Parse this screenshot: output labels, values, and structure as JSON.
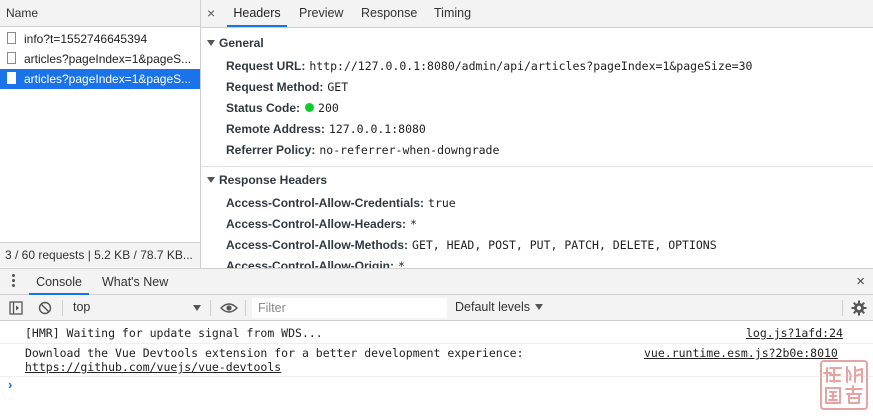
{
  "network": {
    "name_header": "Name",
    "requests": [
      {
        "name": "info?t=1552746645394",
        "selected": false
      },
      {
        "name": "articles?pageIndex=1&pageS...",
        "selected": false
      },
      {
        "name": "articles?pageIndex=1&pageS...",
        "selected": true
      }
    ],
    "summary": "3 / 60 requests | 5.2 KB / 78.7 KB..."
  },
  "detail": {
    "close_glyph": "×",
    "tabs": [
      "Headers",
      "Preview",
      "Response",
      "Timing"
    ],
    "active_tab": "Headers",
    "general": {
      "title": "General",
      "rows": [
        {
          "key": "Request URL:",
          "value": "http://127.0.0.1:8080/admin/api/articles?pageIndex=1&pageSize=30"
        },
        {
          "key": "Request Method:",
          "value": "GET"
        },
        {
          "key": "Status Code:",
          "value": "200"
        },
        {
          "key": "Remote Address:",
          "value": "127.0.0.1:8080"
        },
        {
          "key": "Referrer Policy:",
          "value": "no-referrer-when-downgrade"
        }
      ],
      "status_color": "#0ccc2a"
    },
    "response_headers": {
      "title": "Response Headers",
      "rows": [
        {
          "key": "Access-Control-Allow-Credentials:",
          "value": "true"
        },
        {
          "key": "Access-Control-Allow-Headers:",
          "value": "*"
        },
        {
          "key": "Access-Control-Allow-Methods:",
          "value": "GET, HEAD, POST, PUT, PATCH, DELETE, OPTIONS"
        },
        {
          "key": "Access-Control-Allow-Origin:",
          "value": "*"
        }
      ]
    }
  },
  "drawer": {
    "tabs": [
      "Console",
      "What's New"
    ],
    "active_tab": "Console",
    "close_glyph": "×"
  },
  "console_toolbar": {
    "context": "top",
    "filter_placeholder": "Filter",
    "levels": "Default levels",
    "icons": [
      "sidebar-toggle-icon",
      "clear-console-icon",
      "eye-icon",
      "gear-icon"
    ]
  },
  "console": {
    "messages": [
      {
        "text": "[HMR] Waiting for update signal from WDS...",
        "source": "log.js?1afd:24"
      },
      {
        "text": "Download the Vue Devtools extension for a better development experience:",
        "link": "https://github.com/vuejs/vue-devtools",
        "source": "vue.runtime.esm.js?2b0e:8010"
      }
    ],
    "prompt": "›"
  },
  "colors": {
    "accent": "#1a73e8",
    "toolbar_bg": "#f3f3f3",
    "watermark": "#e7a2a2"
  }
}
